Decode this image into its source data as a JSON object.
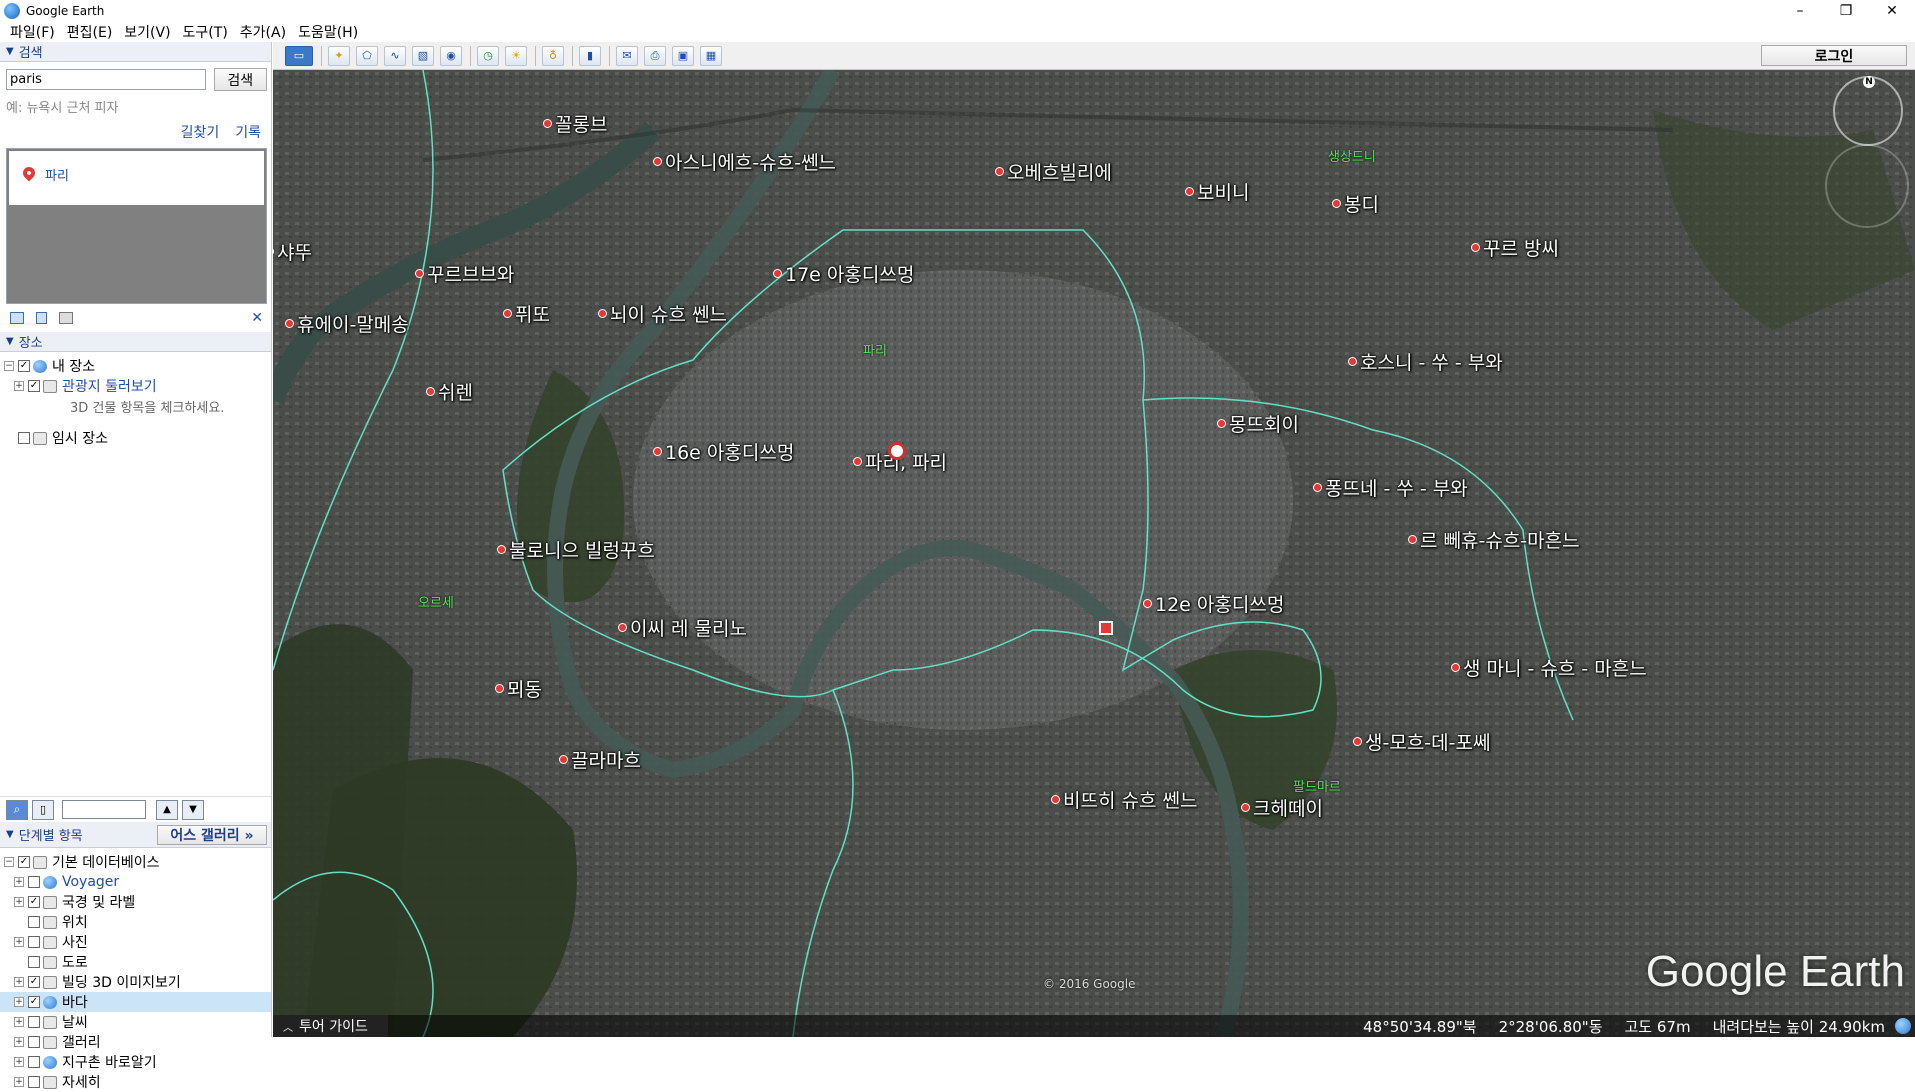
{
  "window": {
    "title": "Google Earth",
    "controls": [
      "–",
      "❐",
      "✕"
    ]
  },
  "menu": [
    "파일(F)",
    "편집(E)",
    "보기(V)",
    "도구(T)",
    "추가(A)",
    "도움말(H)"
  ],
  "search": {
    "header": "검색",
    "value": "paris",
    "button": "검색",
    "hint": "예: 뉴욕시 근처 피자",
    "links": [
      "길찾기",
      "기록"
    ],
    "result": "파리"
  },
  "places": {
    "header": "장소",
    "my_places": "내 장소",
    "tour_folder": "관광지 둘러보기",
    "tour_note": "3D 건물 항목을 체크하세요.",
    "temp_places": "임시 장소"
  },
  "layers": {
    "header": "단계별 항목",
    "gallery_button": "어스 갤러리 »",
    "items": [
      {
        "label": "기본 데이터베이스",
        "checked": true,
        "expander": "⊟",
        "icon": "layers-icon",
        "color": "#000"
      },
      {
        "label": "Voyager",
        "checked": false,
        "expander": "+",
        "icon": "voyager-icon",
        "color": "#1f4ea8"
      },
      {
        "label": "국경 및 라벨",
        "checked": true,
        "expander": "+",
        "icon": "flag-icon",
        "color": "#000"
      },
      {
        "label": "위치",
        "checked": false,
        "expander": "",
        "icon": "location-icon",
        "color": "#000"
      },
      {
        "label": "사진",
        "checked": false,
        "expander": "+",
        "icon": "photo-icon",
        "color": "#000"
      },
      {
        "label": "도로",
        "checked": false,
        "expander": "",
        "icon": "road-icon",
        "color": "#000"
      },
      {
        "label": "빌딩 3D 이미지보기",
        "checked": true,
        "expander": "+",
        "icon": "building-icon",
        "color": "#000"
      },
      {
        "label": "바다",
        "checked": true,
        "expander": "+",
        "icon": "ocean-icon",
        "color": "#000",
        "selected": true
      },
      {
        "label": "날씨",
        "checked": false,
        "expander": "+",
        "icon": "weather-icon",
        "color": "#000"
      },
      {
        "label": "갤러리",
        "checked": false,
        "expander": "+",
        "icon": "gallery-icon",
        "color": "#000"
      },
      {
        "label": "지구촌 바로알기",
        "checked": false,
        "expander": "+",
        "icon": "globe-icon",
        "color": "#000"
      },
      {
        "label": "자세히",
        "checked": false,
        "expander": "+",
        "icon": "more-icon",
        "color": "#000"
      }
    ]
  },
  "toolbar": {
    "login": "로그인"
  },
  "map": {
    "labels": [
      {
        "text": "꼴롱브",
        "name": "label-colombes"
      },
      {
        "text": "아스니에흐-슈흐-쎈느",
        "name": "label-asnieres"
      },
      {
        "text": "오베흐빌리에",
        "name": "label-aubervilliers"
      },
      {
        "text": "보비니",
        "name": "label-bobigny"
      },
      {
        "text": "봉디",
        "name": "label-bondy"
      },
      {
        "text": "샤뚜",
        "name": "label-chatou"
      },
      {
        "text": "꾸르 방씨",
        "name": "label-rosny"
      },
      {
        "text": "꾸르브브와",
        "name": "label-courbevoie"
      },
      {
        "text": "17e 아홍디쓰멍",
        "name": "label-17e"
      },
      {
        "text": "퓌또",
        "name": "label-puteaux"
      },
      {
        "text": "뇌이 슈흐 쎈느",
        "name": "label-neuilly"
      },
      {
        "text": "휴에이-말메송",
        "name": "label-rueil"
      },
      {
        "text": "파리",
        "name": "label-paris-green"
      },
      {
        "text": "호스니 - 쑤 - 부와",
        "name": "label-rosny-sous-bois"
      },
      {
        "text": "쉬렌",
        "name": "label-suresnes"
      },
      {
        "text": "몽뜨회이",
        "name": "label-montreuil"
      },
      {
        "text": "16e 아홍디쓰멍",
        "name": "label-16e"
      },
      {
        "text": "파리, 파리",
        "name": "label-paris"
      },
      {
        "text": "퐁뜨네 - 쑤 - 부와",
        "name": "label-fontenay"
      },
      {
        "text": "르 뻬휴-슈흐-마흔느",
        "name": "label-perreux"
      },
      {
        "text": "불로니으 빌렁꾸흐",
        "name": "label-boulogne"
      },
      {
        "text": "12e 아홍디쓰멍",
        "name": "label-12e"
      },
      {
        "text": "이씨 레 물리노",
        "name": "label-issy"
      },
      {
        "text": "생 마니 - 슈흐 - 마흔느",
        "name": "label-saint-maur"
      },
      {
        "text": "뫼동",
        "name": "label-meudon"
      },
      {
        "text": "생-모흐-데-포쎄",
        "name": "label-saint-maur-fosses"
      },
      {
        "text": "끌라마흐",
        "name": "label-clamart"
      },
      {
        "text": "비뜨히 슈흐 쎈느",
        "name": "label-vitry"
      },
      {
        "text": "크헤떼이",
        "name": "label-creteil"
      }
    ],
    "green_labels": [
      "생상드니",
      "오르세",
      "팔드마르"
    ],
    "watermark": "Google Earth",
    "copyright": "© 2016 Google",
    "tour_guide": "투어 가이드",
    "status": {
      "lat": "48°50'34.89\"북",
      "lon": "2°28'06.80\"동",
      "elev_label": "고도",
      "elev": "67m",
      "eye_label": "내려다보는 높이",
      "eye": "24.90km"
    }
  }
}
